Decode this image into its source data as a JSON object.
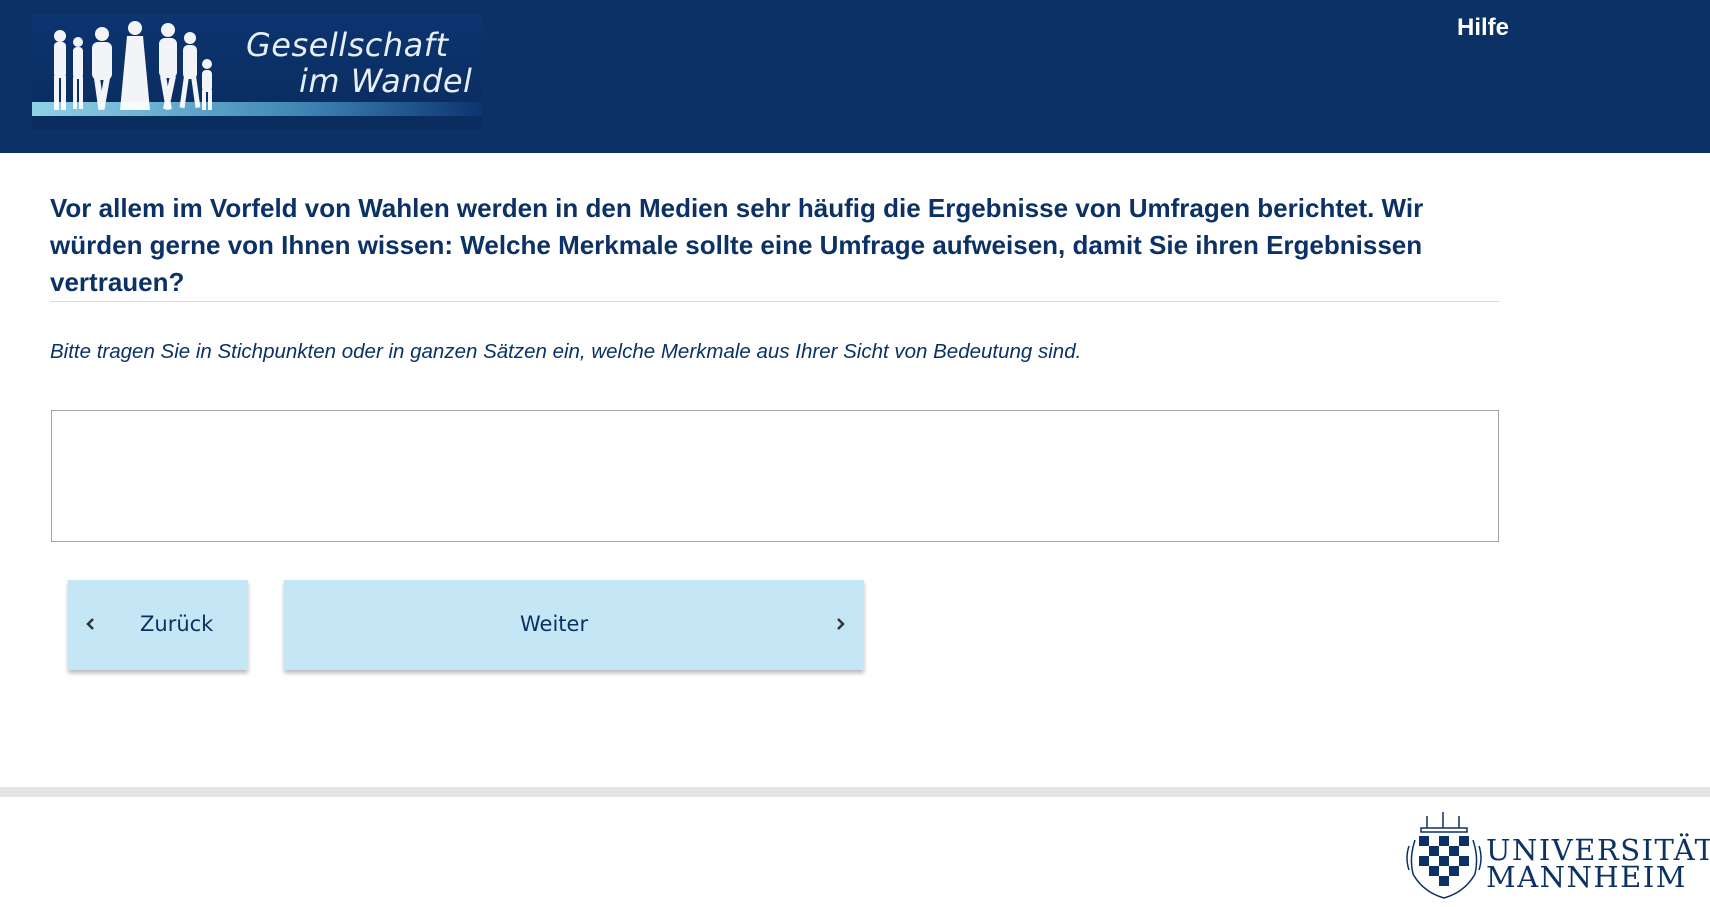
{
  "header": {
    "logo_line1": "Gesellschaft",
    "logo_line2": "im Wandel",
    "help_label": "Hilfe"
  },
  "question": {
    "text": "Vor allem im Vorfeld von Wahlen werden in den Medien sehr häufig die Ergebnisse von Umfragen berichtet. Wir würden gerne von Ihnen wissen: Welche Merkmale sollte eine Umfrage aufweisen, damit Sie ihren Ergebnissen vertrauen?",
    "instruction": "Bitte tragen Sie in Stichpunkten oder in ganzen Sätzen ein, welche Merkmale aus Ihrer Sicht von Bedeutung sind.",
    "answer_value": ""
  },
  "navigation": {
    "back_label": "Zurück",
    "next_label": "Weiter"
  },
  "footer": {
    "university_line1": "UNIVERSITÄT",
    "university_line2": "MANNHEIM"
  },
  "colors": {
    "header_bg": "#0b3166",
    "button_bg": "#c5e6f4",
    "text_primary": "#0b3166"
  }
}
